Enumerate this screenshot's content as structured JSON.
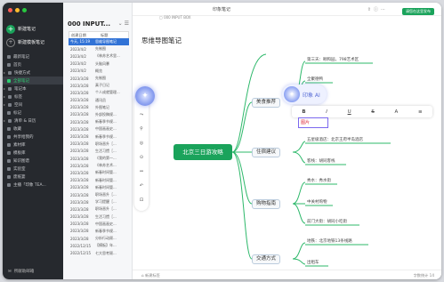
{
  "window": {
    "title": "印象笔记"
  },
  "sidebar": {
    "new_note": "新建笔记",
    "new_template_note": "新建模板笔记",
    "items": [
      {
        "label": "最新笔记"
      },
      {
        "label": "首页"
      },
      {
        "label": "快捷方式"
      },
      {
        "label": "全部笔记",
        "active": true
      },
      {
        "label": "笔记本"
      },
      {
        "label": "标签"
      },
      {
        "label": "空间"
      },
      {
        "label": "标记"
      },
      {
        "label": "清单 & 日历"
      },
      {
        "label": "收藏"
      },
      {
        "label": "共享给我的"
      },
      {
        "label": "素材库"
      },
      {
        "label": "模板库"
      },
      {
        "label": "知识图谱"
      },
      {
        "label": "实验室"
      },
      {
        "label": "废纸篓"
      },
      {
        "label": "主播「印象 TEA..."
      }
    ],
    "footer": "所献助邮箱"
  },
  "list": {
    "title": "000 INPUT...",
    "col_date": "创建日期",
    "col_title": "标题",
    "rows": [
      {
        "date": "今天, 15:19",
        "title": "思维导图笔记",
        "selected": true
      },
      {
        "date": "2023/4/2",
        "title": "先制图"
      },
      {
        "date": "2023/4/2",
        "title": "《林苏艺术里..."
      },
      {
        "date": "2023/4/2",
        "title": "头脑风暴"
      },
      {
        "date": "2023/4/2",
        "title": "概览"
      },
      {
        "date": "2023/3/28",
        "title": "先制图"
      },
      {
        "date": "2023/3/28",
        "title": "真子日记"
      },
      {
        "date": "2023/3/28",
        "title": "个人成就管理..."
      },
      {
        "date": "2023/3/28",
        "title": "通讯员"
      },
      {
        "date": "2023/3/28",
        "title": "外图笔记"
      },
      {
        "date": "2023/3/28",
        "title": "外部投稿规..."
      },
      {
        "date": "2023/3/28",
        "title": "新春季节规..."
      },
      {
        "date": "2023/3/28",
        "title": "中国画画史..."
      },
      {
        "date": "2023/3/28",
        "title": "新春季节规..."
      },
      {
        "date": "2023/3/28",
        "title": "职场晋升［..."
      },
      {
        "date": "2023/3/28",
        "title": "生活习惯［..."
      },
      {
        "date": "2023/3/28",
        "title": "《我的第一..."
      },
      {
        "date": "2023/3/28",
        "title": "《林苏艺术..."
      },
      {
        "date": "2023/3/28",
        "title": "新春时间管..."
      },
      {
        "date": "2023/3/28",
        "title": "新春时间管..."
      },
      {
        "date": "2023/3/28",
        "title": "新春时间管..."
      },
      {
        "date": "2023/3/28",
        "title": "职场晋升［..."
      },
      {
        "date": "2023/3/28",
        "title": "学习提醒［..."
      },
      {
        "date": "2023/3/28",
        "title": "职场晋升［..."
      },
      {
        "date": "2023/3/28",
        "title": "生活习惯［..."
      },
      {
        "date": "2023/3/28",
        "title": "中国画画史..."
      },
      {
        "date": "2023/3/28",
        "title": "新春季节规..."
      },
      {
        "date": "2023/3/28",
        "title": "分析行动顾..."
      },
      {
        "date": "2022/12/15",
        "title": "【模板】年..."
      },
      {
        "date": "2022/12/15",
        "title": "七大思考顾..."
      }
    ]
  },
  "main": {
    "path": "000 INPUT BOX",
    "note_title": "思维导图笔记",
    "view_button": "请您在这里发布",
    "status_left": "新建标签",
    "status_right": "字数统计 14"
  },
  "mindmap": {
    "root": "北京三日游攻略",
    "ai_label": "印象 AI",
    "editing_text": "图片",
    "branches": [
      {
        "label": "美食推荐",
        "leaves": [
          "第三天：颐和园，798艺术区",
          "全聚德鸭",
          "北京烤鸭"
        ]
      },
      {
        "label": "住宿建议",
        "leaves": [
          "五星级酒店：北京王府半岛酒店",
          "客栈：胡同客栈"
        ]
      },
      {
        "label": "购物指南",
        "leaves": [
          "秀水：秀水街",
          "中关村购物",
          "前门大街：胡同小吃街"
        ]
      },
      {
        "label": "交通方式",
        "leaves": [
          "地铁：北京地铁13条线路",
          "出租车"
        ]
      }
    ]
  },
  "format_bar": [
    "B",
    "I",
    "U",
    "S",
    "A",
    "≡"
  ],
  "colors": {
    "accent": "#1aa35b",
    "sidebar_bg": "#26292e",
    "selection": "#3273d6",
    "ai": "#6f84e2"
  }
}
